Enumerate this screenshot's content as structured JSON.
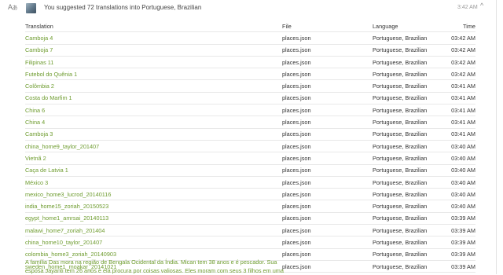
{
  "header": {
    "translate_icon": "translate-icon",
    "headline": "You suggested 72 translations into Portuguese, Brazilian",
    "time": "3:42 AM",
    "collapse_icon": "chevron-up-icon",
    "collapse_glyph": "^"
  },
  "table": {
    "columns": [
      "Translation",
      "File",
      "Language",
      "Time"
    ],
    "rows": [
      {
        "translation": "Camboja 4",
        "file": "places.json",
        "language": "Portuguese, Brazilian",
        "time": "03:42 AM"
      },
      {
        "translation": "Camboja 7",
        "file": "places.json",
        "language": "Portuguese, Brazilian",
        "time": "03:42 AM"
      },
      {
        "translation": "Filipinas 11",
        "file": "places.json",
        "language": "Portuguese, Brazilian",
        "time": "03:42 AM"
      },
      {
        "translation": "Futebol do Quênia 1",
        "file": "places.json",
        "language": "Portuguese, Brazilian",
        "time": "03:42 AM"
      },
      {
        "translation": "Colômbia 2",
        "file": "places.json",
        "language": "Portuguese, Brazilian",
        "time": "03:41 AM"
      },
      {
        "translation": "Costa do Marfim 1",
        "file": "places.json",
        "language": "Portuguese, Brazilian",
        "time": "03:41 AM"
      },
      {
        "translation": "China 6",
        "file": "places.json",
        "language": "Portuguese, Brazilian",
        "time": "03:41 AM"
      },
      {
        "translation": "China 4",
        "file": "places.json",
        "language": "Portuguese, Brazilian",
        "time": "03:41 AM"
      },
      {
        "translation": "Camboja 3",
        "file": "places.json",
        "language": "Portuguese, Brazilian",
        "time": "03:41 AM"
      },
      {
        "translation": "china_home9_taylor_201407",
        "file": "places.json",
        "language": "Portuguese, Brazilian",
        "time": "03:40 AM"
      },
      {
        "translation": "Vietnã 2",
        "file": "places.json",
        "language": "Portuguese, Brazilian",
        "time": "03:40 AM"
      },
      {
        "translation": "Caça de Latvia 1",
        "file": "places.json",
        "language": "Portuguese, Brazilian",
        "time": "03:40 AM"
      },
      {
        "translation": "México 3",
        "file": "places.json",
        "language": "Portuguese, Brazilian",
        "time": "03:40 AM"
      },
      {
        "translation": "mexico_home3_lucrod_20140116",
        "file": "places.json",
        "language": "Portuguese, Brazilian",
        "time": "03:40 AM"
      },
      {
        "translation": "india_home15_zoriah_20150523",
        "file": "places.json",
        "language": "Portuguese, Brazilian",
        "time": "03:40 AM"
      },
      {
        "translation": "egypt_home1_amrsai_20140113",
        "file": "places.json",
        "language": "Portuguese, Brazilian",
        "time": "03:39 AM"
      },
      {
        "translation": "malawi_home7_zoriah_201404",
        "file": "places.json",
        "language": "Portuguese, Brazilian",
        "time": "03:39 AM"
      },
      {
        "translation": "china_home10_taylor_201407",
        "file": "places.json",
        "language": "Portuguese, Brazilian",
        "time": "03:39 AM"
      },
      {
        "translation": "colombia_home3_zoriah_20140903",
        "file": "places.json",
        "language": "Portuguese, Brazilian",
        "time": "03:39 AM"
      },
      {
        "translation": "sweden_home1_moakar_20141021",
        "file": "places.json",
        "language": "Portuguese, Brazilian",
        "time": "03:39 AM"
      }
    ]
  },
  "excerpt": {
    "text": "A família Das mora na região de Bengala Ocidental da Índia. Mican tem 38 anos e é pescador. Sua esposa Jayanti tem 26 anos e ela procura por coisas valiosas. Eles moram com seus 3 filhos em uma"
  },
  "colors": {
    "link_green": "#6e9c2f",
    "muted_gray": "#9a9a9a",
    "row_border": "#e8e8e8"
  }
}
